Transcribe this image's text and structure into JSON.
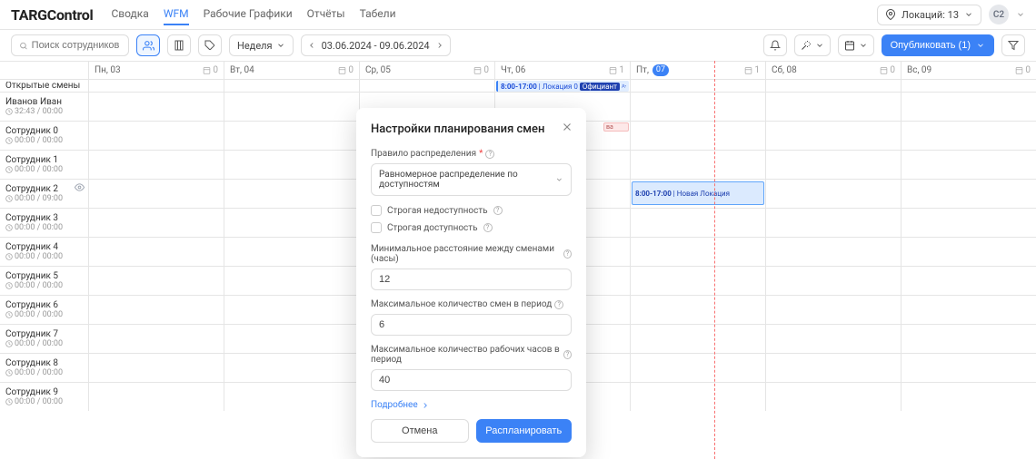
{
  "brand": "TARGControl",
  "nav": [
    "Сводка",
    "WFM",
    "Рабочие Графики",
    "Отчёты",
    "Табели"
  ],
  "nav_active": 1,
  "location_btn": "Локаций: 13",
  "avatar": "C2",
  "search_placeholder": "Поиск сотрудников",
  "period_label": "Неделя",
  "date_range": "03.06.2024 - 09.06.2024",
  "publish_label": "Опубликовать (1)",
  "days": [
    {
      "label": "Пн, 03",
      "count": "0"
    },
    {
      "label": "Вт, 04",
      "count": "0"
    },
    {
      "label": "Ср, 05",
      "count": "0"
    },
    {
      "label": "Чт, 06",
      "count": "1"
    },
    {
      "label": "Пт,",
      "badge": "07",
      "count": "1"
    },
    {
      "label": "Сб, 08",
      "count": "0"
    },
    {
      "label": "Вс, 09",
      "count": "0"
    }
  ],
  "open_shifts_label": "Открытые смены",
  "open_shift": {
    "time": "8:00-17:00",
    "loc": "Локация 0",
    "tag": "Официант"
  },
  "shift2": {
    "time": "8:00-17:00",
    "loc": "Новая Локация"
  },
  "peek": "ва",
  "employees": [
    {
      "name": "Иванов Иван",
      "sub": "32:43 / 00:00"
    },
    {
      "name": "Сотрудник 0",
      "sub": "00:00 / 00:00"
    },
    {
      "name": "Сотрудник 1",
      "sub": "00:00 / 00:00"
    },
    {
      "name": "Сотрудник 2",
      "sub": "00:00 / 09:00",
      "eye": true
    },
    {
      "name": "Сотрудник 3",
      "sub": "00:00 / 00:00"
    },
    {
      "name": "Сотрудник 4",
      "sub": "00:00 / 00:00"
    },
    {
      "name": "Сотрудник 5",
      "sub": "00:00 / 00:00"
    },
    {
      "name": "Сотрудник 6",
      "sub": "00:00 / 00:00"
    },
    {
      "name": "Сотрудник 7",
      "sub": "00:00 / 00:00"
    },
    {
      "name": "Сотрудник 8",
      "sub": "00:00 / 00:00"
    },
    {
      "name": "Сотрудник 9",
      "sub": "00:00 / 00:00"
    }
  ],
  "modal": {
    "title": "Настройки планирования смен",
    "rule_label": "Правило распределения",
    "rule_value": "Равномерное распределение по доступностям",
    "check1": "Строгая недоступность",
    "check2": "Строгая доступность",
    "gap_label": "Минимальное расстояние между сменами (часы)",
    "gap_value": "12",
    "maxshifts_label": "Максимальное количество смен в период",
    "maxshifts_value": "6",
    "maxhours_label": "Максимальное количество рабочих часов в период",
    "maxhours_value": "40",
    "more": "Подробнее",
    "cancel": "Отмена",
    "submit": "Распланировать"
  }
}
